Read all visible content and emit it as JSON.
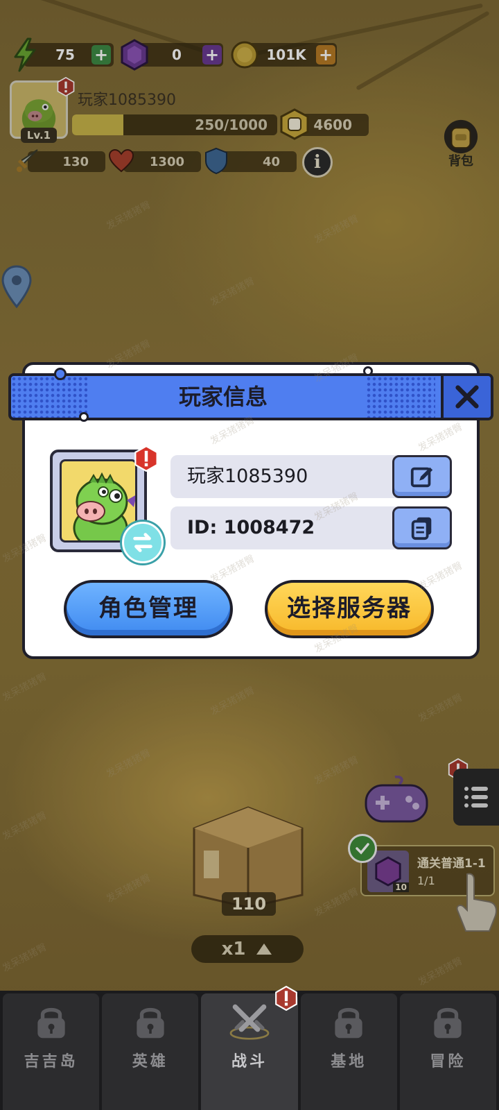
{
  "resources": {
    "energy": "75",
    "gems": "0",
    "coins": "101K"
  },
  "player": {
    "name": "玩家1085390",
    "level": "Lv.1",
    "xp": "250/1000",
    "xp_fraction": 0.25,
    "power": "4600",
    "attack": "130",
    "hp": "1300",
    "defense": "40"
  },
  "bag": {
    "label": "背包"
  },
  "dialog": {
    "title": "玩家信息",
    "name_value": "玩家1085390",
    "id_value": "ID: 1008472",
    "role_button": "角色管理",
    "server_button": "选择服务器"
  },
  "scene": {
    "chest_count": "110",
    "speed": "x1",
    "quest_title": "通关普通1-1",
    "quest_progress": "1/1",
    "quest_reward_count": "10"
  },
  "nav": {
    "tabs": [
      {
        "label": "吉吉岛",
        "locked": true
      },
      {
        "label": "英雄",
        "locked": true
      },
      {
        "label": "战斗",
        "locked": false
      },
      {
        "label": "基地",
        "locked": true
      },
      {
        "label": "冒险",
        "locked": true
      }
    ]
  },
  "watermark": "发呆猪猪臀",
  "colors": {
    "header_blue": "#4f7ef0",
    "button_blue": "#3f8af0",
    "button_yellow": "#f7b82a",
    "alert_red": "#d8342a"
  }
}
